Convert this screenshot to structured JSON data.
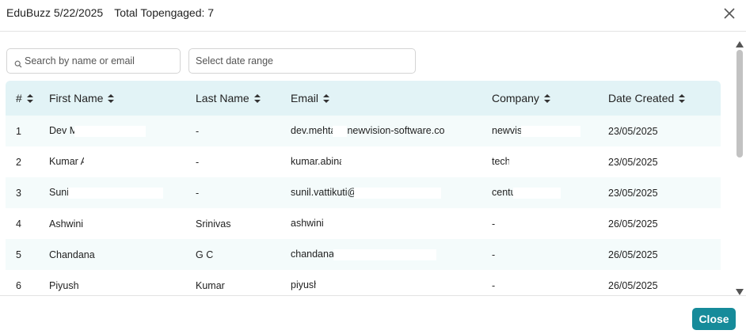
{
  "header": {
    "title": "EduBuzz 5/22/2025",
    "count_label": "Total Topengaged: 7",
    "close_icon": "close-icon"
  },
  "filters": {
    "search_placeholder": "Search by name or email",
    "date_placeholder": "Select date range"
  },
  "table": {
    "columns": [
      "#",
      "First Name",
      "Last Name",
      "Email",
      "Company",
      "Date Created"
    ],
    "rows": [
      {
        "num": "1",
        "first": "Dev M",
        "last": "-",
        "email": "dev.mehta",
        "email2": "newvision-software.co",
        "company": "newvisi",
        "date": "23/05/2025"
      },
      {
        "num": "2",
        "first": "Kumar A",
        "last": "-",
        "email": "kumar.abina",
        "email2": "",
        "company": "techj",
        "date": "23/05/2025"
      },
      {
        "num": "3",
        "first": "Sunil",
        "last": "-",
        "email": "sunil.vattikuti@",
        "email2": "",
        "company": "centu",
        "date": "23/05/2025"
      },
      {
        "num": "4",
        "first": "Ashwini",
        "last": "Srinivas",
        "email": "ashwini.",
        "email2": "",
        "company": "-",
        "date": "26/05/2025"
      },
      {
        "num": "5",
        "first": "Chandana",
        "last": "G C",
        "email": "chandana.",
        "email2": "",
        "company": "-",
        "date": "26/05/2025"
      },
      {
        "num": "6",
        "first": "Piyush",
        "last": "Kumar",
        "email": "piyush",
        "email2": "",
        "company": "-",
        "date": "26/05/2025"
      }
    ]
  },
  "footer": {
    "close_label": "Close"
  },
  "colors": {
    "header_bg": "#e2f3f6",
    "stripe_bg": "#f4fbfb",
    "accent": "#168b9a"
  }
}
